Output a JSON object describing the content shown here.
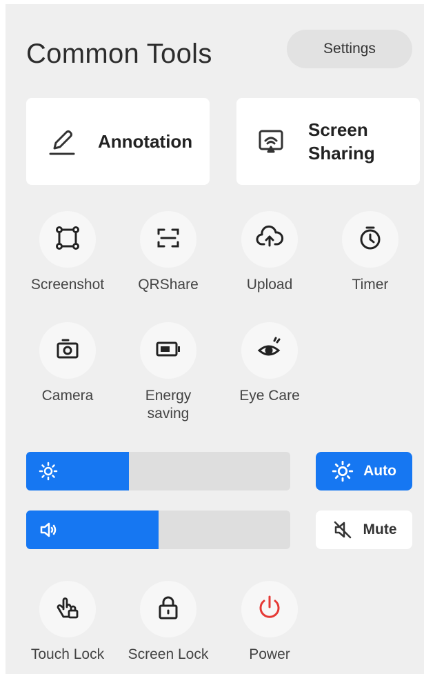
{
  "header": {
    "title": "Common Tools",
    "settings_label": "Settings"
  },
  "primary_cards": [
    {
      "label": "Annotation",
      "icon": "pen-icon"
    },
    {
      "label": "Screen\nSharing",
      "icon": "screen-cast-icon"
    }
  ],
  "tools": [
    {
      "label": "Screenshot",
      "icon": "screenshot-crop-icon"
    },
    {
      "label": "QRShare",
      "icon": "qr-scan-icon"
    },
    {
      "label": "Upload",
      "icon": "cloud-upload-icon"
    },
    {
      "label": "Timer",
      "icon": "timer-icon"
    },
    {
      "label": "Camera",
      "icon": "camera-icon"
    },
    {
      "label": "Energy\nsaving",
      "icon": "battery-icon"
    },
    {
      "label": "Eye Care",
      "icon": "eye-care-icon"
    },
    {
      "label": "Touch Lock",
      "icon": "touch-lock-icon"
    },
    {
      "label": "Screen Lock",
      "icon": "padlock-icon"
    },
    {
      "label": "Power",
      "icon": "power-icon"
    }
  ],
  "brightness": {
    "level": 0.39,
    "auto_label": "Auto",
    "icon": "sun-icon"
  },
  "volume": {
    "level": 0.5,
    "mute_label": "Mute",
    "icon": "speaker-icon",
    "mute_icon": "speaker-muted-icon"
  },
  "colors": {
    "accent": "#1677f2",
    "power": "#e53935",
    "panel": "#efefef"
  }
}
